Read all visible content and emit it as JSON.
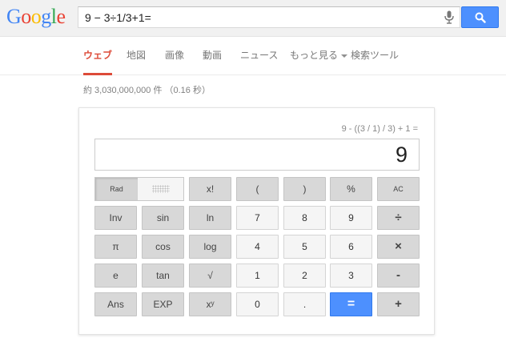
{
  "brand": {
    "logo_letters": [
      {
        "ch": "G",
        "color": "#4285f4"
      },
      {
        "ch": "o",
        "color": "#ea4335"
      },
      {
        "ch": "o",
        "color": "#fbbc05"
      },
      {
        "ch": "g",
        "color": "#4285f4"
      },
      {
        "ch": "l",
        "color": "#34a853"
      },
      {
        "ch": "e",
        "color": "#ea4335"
      }
    ],
    "accent": "#dd4b39",
    "search_button_color": "#4d90fe"
  },
  "search": {
    "query": "9 − 3÷1/3+1=",
    "mic_icon": "microphone-icon",
    "search_icon": "magnifier-icon"
  },
  "tabs": [
    {
      "label": "ウェブ",
      "active": true
    },
    {
      "label": "地図",
      "active": false
    },
    {
      "label": "画像",
      "active": false
    },
    {
      "label": "動画",
      "active": false
    },
    {
      "label": "ニュース",
      "active": false
    },
    {
      "label": "もっと見る",
      "active": false,
      "dropdown": true
    },
    {
      "label": "検索ツール",
      "active": false
    }
  ],
  "result_stats": "約 3,030,000,000 件 （0.16 秒）",
  "calculator": {
    "expression": "9 - ((3 / 1) / 3) + 1 =",
    "display": "9",
    "mode_toggle": {
      "rad_label": "Rad"
    },
    "keys": {
      "factorial": "x!",
      "paren_open": "(",
      "paren_close": ")",
      "percent": "%",
      "clear": "AC",
      "inv": "Inv",
      "sin": "sin",
      "ln": "ln",
      "seven": "7",
      "eight": "8",
      "nine": "9",
      "divide": "÷",
      "pi": "π",
      "cos": "cos",
      "log": "log",
      "four": "4",
      "five": "5",
      "six": "6",
      "multiply": "×",
      "e": "e",
      "tan": "tan",
      "sqrt": "√",
      "one": "1",
      "two": "2",
      "three": "3",
      "minus": "-",
      "ans": "Ans",
      "exp": "EXP",
      "power": "xʸ",
      "zero": "0",
      "decimal": ".",
      "equals": "=",
      "plus": "+"
    }
  }
}
